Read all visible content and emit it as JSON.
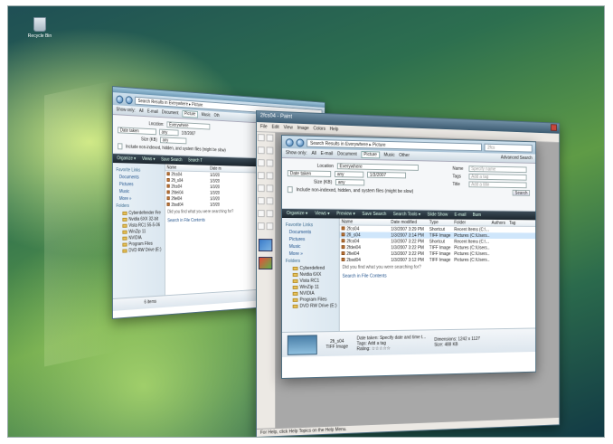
{
  "desktop": {
    "recycle_label": "Recycle Bin"
  },
  "back_window": {
    "address": "Search Results in Everywhere ▸ Picture",
    "showonly": [
      "Show only:",
      "All",
      "E-mail",
      "Document",
      "Picture",
      "Music",
      "Oth"
    ],
    "location_label": "Location:",
    "location_value": "Everywhere",
    "date_label": "Date taken",
    "date_op": "any",
    "date_value": "1/3/2007",
    "size_label": "Size (KB)",
    "size_value": "any",
    "include_label": "Include non-indexed, hidden, and system files (might be slow)",
    "toolbar": [
      "Organize ▾",
      "Views ▾",
      "Save Search",
      "Search T"
    ],
    "fav_header": "Favorite Links",
    "fav_links": [
      "Documents",
      "Pictures",
      "Music",
      "More »"
    ],
    "folders_header": "Folders",
    "folders": [
      "Cyberdefender Fre",
      "Nvidia 6XX 32-bit",
      "Vista RC1 55-5-06",
      "WinZip 11",
      "NVIDIA",
      "Program Files",
      "DVD RW Drive (E:)"
    ],
    "columns": [
      "Name",
      "Date m"
    ],
    "files": [
      {
        "name": "2fcs04",
        "date": "1/3/20"
      },
      {
        "name": "2fi_s04",
        "date": "1/3/20"
      },
      {
        "name": "2fcs04",
        "date": "1/3/20"
      },
      {
        "name": "2fdei04",
        "date": "1/3/20"
      },
      {
        "name": "2fiel04",
        "date": "1/3/20"
      },
      {
        "name": "2bsd04",
        "date": "1/3/20"
      }
    ],
    "no_find": "Did you find what you were searching for?",
    "search_contents": "Search in File Contents",
    "count": "6 items"
  },
  "paint_window": {
    "title": "2fcs04 - Paint",
    "menu": [
      "File",
      "Edit",
      "View",
      "Image",
      "Colors",
      "Help"
    ],
    "status": "For Help, click Help Topics on the Help Menu."
  },
  "front_window": {
    "address": "Search Results in Everywhere ▸ Picture",
    "search_placeholder": "2fcs",
    "showonly": [
      "Show only:",
      "All",
      "E-mail",
      "Document",
      "Picture",
      "Music",
      "Other"
    ],
    "advanced": "Advanced Search",
    "location_label": "Location",
    "location_value": "Everywhere",
    "date_label": "Date taken",
    "date_op": "any",
    "date_value": "1/3/2007",
    "size_label": "Size (KB)",
    "size_value": "any",
    "name_label": "Name",
    "name_placeholder": "Specify name",
    "tags_label": "Tags",
    "tags_placeholder": "Add a tag",
    "authors_label": "Title",
    "authors_placeholder": "Add a title",
    "search_button": "Search",
    "include_label": "Include non-indexed, hidden, and system files (might be slow)",
    "toolbar": [
      "Organize ▾",
      "Views ▾",
      "Preview ▾",
      "Save Search",
      "Search Tools ▾",
      "Slide Show",
      "E-mail",
      "Burn"
    ],
    "fav_header": "Favorite Links",
    "fav_links": [
      "Documents",
      "Pictures",
      "Music",
      "More »"
    ],
    "folders_header": "Folders",
    "folders": [
      "Cyberdefend",
      "Nvidia 6XX",
      "Vista RC1",
      "WinZip 11",
      "NVIDIA",
      "Program Files",
      "DVD RW Drive (E:)"
    ],
    "columns": [
      "Name",
      "Date modified",
      "Type",
      "Folder",
      "Authors",
      "Tag"
    ],
    "files": [
      {
        "name": "2fcs04",
        "date": "1/3/2007 3:29 PM",
        "type": "Shortcut",
        "folder": "Recent Items (C:\\..."
      },
      {
        "name": "2fi_s04",
        "date": "1/3/2007 3:14 PM",
        "type": "TIFF Image",
        "folder": "Pictures (C:\\Users..."
      },
      {
        "name": "2fcs04",
        "date": "1/3/2007 3:22 PM",
        "type": "Shortcut",
        "folder": "Recent Items (C:\\..."
      },
      {
        "name": "2fdei04",
        "date": "1/3/2007 3:22 PM",
        "type": "TIFF Image",
        "folder": "Pictures (C:\\Users..."
      },
      {
        "name": "2fiel04",
        "date": "1/3/2007 3:22 PM",
        "type": "TIFF Image",
        "folder": "Pictures (C:\\Users..."
      },
      {
        "name": "2bsd04",
        "date": "1/3/2007 3:12 PM",
        "type": "TIFF Image",
        "folder": "Pictures (C:\\Users..."
      }
    ],
    "no_find": "Did you find what you were searching for?",
    "search_contents": "Search in File Contents",
    "details": {
      "name": "2fi_s04",
      "type": "TIFF Image",
      "dims_label": "Dimensions:",
      "dims_value": "1242 x 1127",
      "tags_label": "Tags:",
      "tags_value": "Add a tag",
      "size_label": "Size:",
      "size_value": "488 KB",
      "rating_label": "Rating:",
      "taken_label": "Date taken:",
      "taken_value": "Specify date and time t..."
    }
  }
}
